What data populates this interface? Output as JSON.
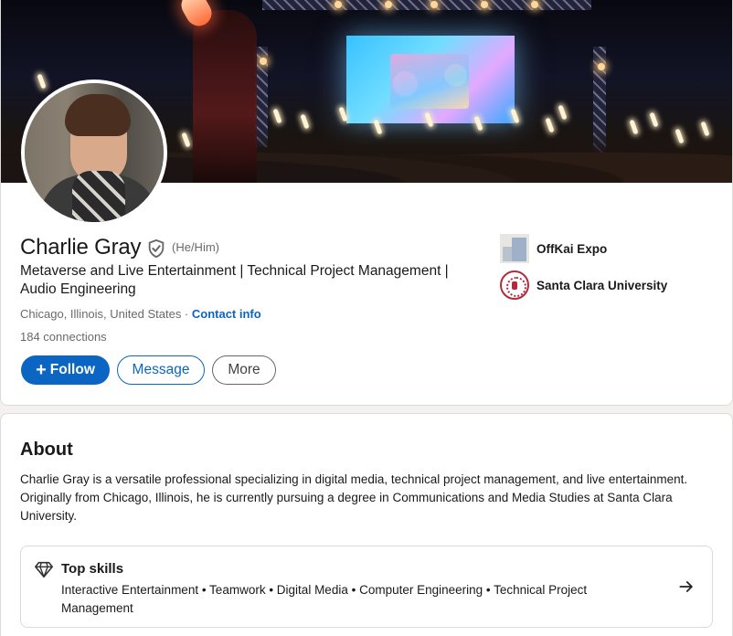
{
  "profile": {
    "name": "Charlie Gray",
    "pronouns": "(He/Him)",
    "headline": "Metaverse and Live Entertainment | Technical Project Management | Audio Engineering",
    "location": "Chicago, Illinois, United States",
    "separator": " · ",
    "contact_info": "Contact info",
    "connections": "184 connections",
    "verified_icon": "verified-shield-icon"
  },
  "actions": {
    "follow": "Follow",
    "follow_icon": "+",
    "message": "Message",
    "more": "More"
  },
  "organizations": [
    {
      "name": "OffKai Expo",
      "icon": "company-logo"
    },
    {
      "name": "Santa Clara University",
      "icon": "university-seal-logo"
    }
  ],
  "about": {
    "title": "About",
    "text": "Charlie Gray is a versatile professional specializing in digital media, technical project management, and live entertainment. Originally from Chicago, Illinois, he is currently pursuing a degree in Communications and Media Studies at Santa Clara University."
  },
  "top_skills": {
    "title": "Top skills",
    "skills": "Interactive Entertainment • Teamwork • Digital Media • Computer Engineering • Technical Project Management",
    "icon": "diamond-icon",
    "arrow": "→"
  },
  "colors": {
    "accent": "#0a66c2",
    "background": "#f3f2ef",
    "card": "#ffffff"
  }
}
